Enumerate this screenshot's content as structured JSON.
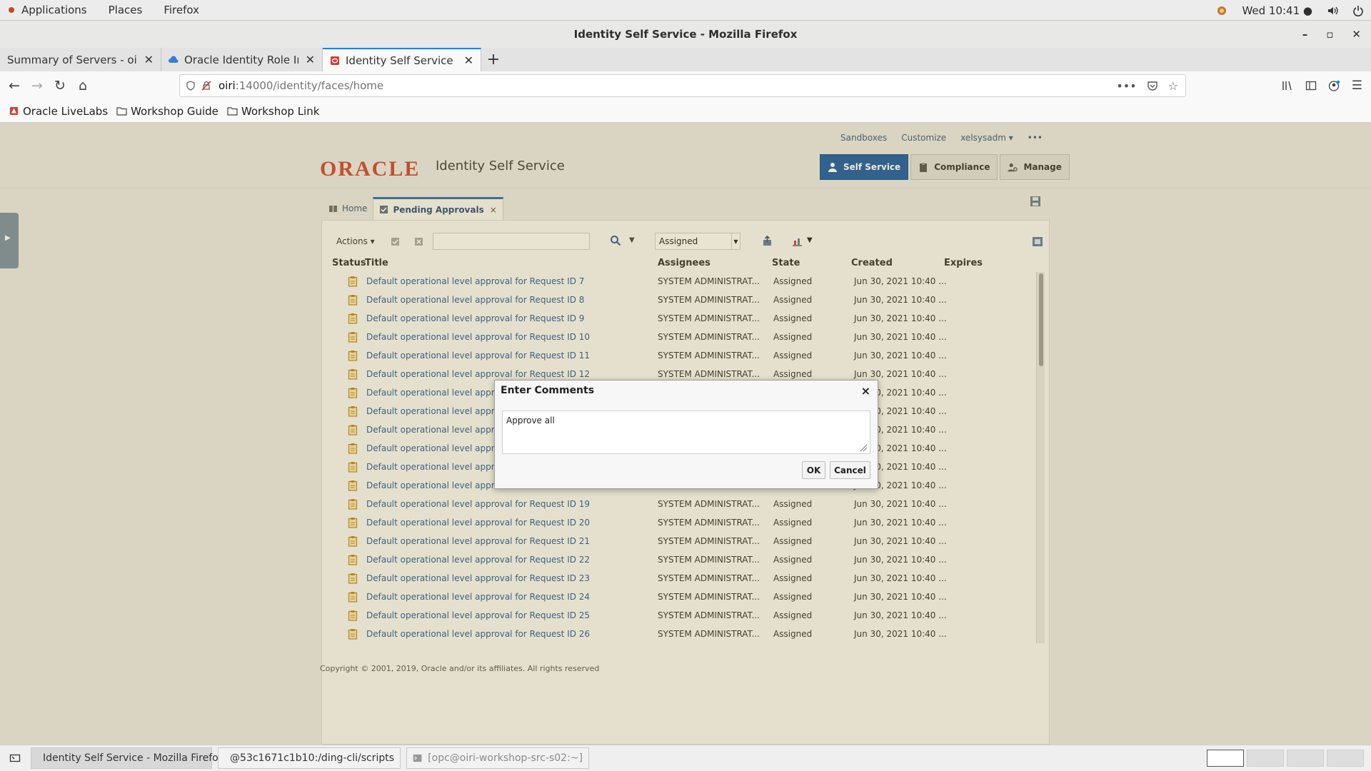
{
  "gnome": {
    "applications": "Applications",
    "places": "Places",
    "firefox": "Firefox",
    "clock": "Wed 10:41 ●"
  },
  "window": {
    "title": "Identity Self Service - Mozilla Firefox"
  },
  "tabs": [
    {
      "label": "Summary of Servers - oig_d",
      "active": false
    },
    {
      "label": "Oracle Identity Role Intell",
      "active": false
    },
    {
      "label": "Identity Self Service",
      "active": true
    }
  ],
  "url": {
    "host": "oiri",
    "path": ":14000/identity/faces/home"
  },
  "bookmarks": [
    {
      "label": "Oracle LiveLabs"
    },
    {
      "label": "Workshop Guide"
    },
    {
      "label": "Workshop Link"
    }
  ],
  "app": {
    "top_links": {
      "sandboxes": "Sandboxes",
      "customize": "Customize",
      "user": "xelsysadm ▾",
      "more": "•••"
    },
    "logo": "ORACLE",
    "title": "Identity Self Service",
    "nav": {
      "self_service": "Self Service",
      "compliance": "Compliance",
      "manage": "Manage"
    },
    "page_tabs": {
      "home": "Home",
      "pending": "Pending Approvals",
      "close": "×"
    },
    "toolbar": {
      "actions": "Actions ▾",
      "state_value": "Assigned"
    },
    "columns": {
      "status": "Status",
      "title": "Title",
      "assignees": "Assignees",
      "state": "State",
      "created": "Created",
      "expires": "Expires"
    },
    "rows": [
      {
        "title": "Default operational level approval for Request ID 7",
        "assignees": "SYSTEM ADMINISTRAT...",
        "state": "Assigned",
        "created": "Jun 30, 2021 10:40 ..."
      },
      {
        "title": "Default operational level approval for Request ID 8",
        "assignees": "SYSTEM ADMINISTRAT...",
        "state": "Assigned",
        "created": "Jun 30, 2021 10:40 ..."
      },
      {
        "title": "Default operational level approval for Request ID 9",
        "assignees": "SYSTEM ADMINISTRAT...",
        "state": "Assigned",
        "created": "Jun 30, 2021 10:40 ..."
      },
      {
        "title": "Default operational level approval for Request ID 10",
        "assignees": "SYSTEM ADMINISTRAT...",
        "state": "Assigned",
        "created": "Jun 30, 2021 10:40 ..."
      },
      {
        "title": "Default operational level approval for Request ID 11",
        "assignees": "SYSTEM ADMINISTRAT...",
        "state": "Assigned",
        "created": "Jun 30, 2021 10:40 ..."
      },
      {
        "title": "Default operational level approval for Request ID 12",
        "assignees": "SYSTEM ADMINISTRAT...",
        "state": "Assigned",
        "created": "Jun 30, 2021 10:40 ..."
      },
      {
        "title": "Default operational level approval",
        "assignees": "",
        "state": "",
        "created": "Jun 30, 2021 10:40 ..."
      },
      {
        "title": "Default operational level approval",
        "assignees": "",
        "state": "",
        "created": "Jun 30, 2021 10:40 ..."
      },
      {
        "title": "Default operational level approval",
        "assignees": "",
        "state": "",
        "created": "Jun 30, 2021 10:40 ..."
      },
      {
        "title": "Default operational level approval",
        "assignees": "",
        "state": "",
        "created": "Jun 30, 2021 10:40 ..."
      },
      {
        "title": "Default operational level approval",
        "assignees": "",
        "state": "",
        "created": "Jun 30, 2021 10:40 ..."
      },
      {
        "title": "Default operational level approval",
        "assignees": "",
        "state": "",
        "created": "Jun 30, 2021 10:40 ..."
      },
      {
        "title": "Default operational level approval for Request ID 19",
        "assignees": "SYSTEM ADMINISTRAT...",
        "state": "Assigned",
        "created": "Jun 30, 2021 10:40 ..."
      },
      {
        "title": "Default operational level approval for Request ID 20",
        "assignees": "SYSTEM ADMINISTRAT...",
        "state": "Assigned",
        "created": "Jun 30, 2021 10:40 ..."
      },
      {
        "title": "Default operational level approval for Request ID 21",
        "assignees": "SYSTEM ADMINISTRAT...",
        "state": "Assigned",
        "created": "Jun 30, 2021 10:40 ..."
      },
      {
        "title": "Default operational level approval for Request ID 22",
        "assignees": "SYSTEM ADMINISTRAT...",
        "state": "Assigned",
        "created": "Jun 30, 2021 10:40 ..."
      },
      {
        "title": "Default operational level approval for Request ID 23",
        "assignees": "SYSTEM ADMINISTRAT...",
        "state": "Assigned",
        "created": "Jun 30, 2021 10:40 ..."
      },
      {
        "title": "Default operational level approval for Request ID 24",
        "assignees": "SYSTEM ADMINISTRAT...",
        "state": "Assigned",
        "created": "Jun 30, 2021 10:40 ..."
      },
      {
        "title": "Default operational level approval for Request ID 25",
        "assignees": "SYSTEM ADMINISTRAT...",
        "state": "Assigned",
        "created": "Jun 30, 2021 10:40 ..."
      },
      {
        "title": "Default operational level approval for Request ID 26",
        "assignees": "SYSTEM ADMINISTRAT...",
        "state": "Assigned",
        "created": "Jun 30, 2021 10:40 ..."
      }
    ],
    "copyright": "Copyright © 2001, 2019, Oracle and/or its affiliates. All rights reserved"
  },
  "dialog": {
    "title": "Enter Comments",
    "close": "×",
    "comment_value": "Approve all",
    "ok": "OK",
    "cancel": "Cancel"
  },
  "taskbar": [
    {
      "label": "Identity Self Service - Mozilla Firefox",
      "active": true
    },
    {
      "label": "@53c1671c1b10:/ding-cli/scripts",
      "active": false
    },
    {
      "label": "[opc@oiri-workshop-src-s02:~]",
      "active": false
    }
  ],
  "colors": {
    "oracle_red": "#c74634",
    "nav_active": "#1e5ba8",
    "link": "#2b5a99"
  }
}
